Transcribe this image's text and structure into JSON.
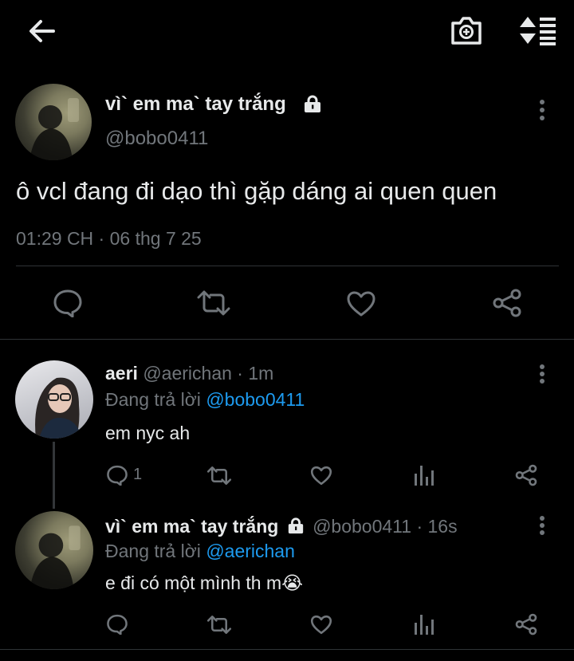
{
  "main_tweet": {
    "display_name": "vì` em ma` tay trắng",
    "handle": "@bobo0411",
    "text": "ô vcl đang đi dạo thì gặp dáng ai quen quen",
    "timestamp": "01:29 CH · 06 thg 7 25"
  },
  "replies": [
    {
      "display_name": "aeri",
      "handle_time": "@aerichan · 1m",
      "replying_prefix": "Đang trả lời",
      "replying_to": "@bobo0411",
      "text": "em nyc ah",
      "reply_count": "1"
    },
    {
      "display_name": "vì` em ma` tay trắng",
      "handle_time": "@bobo0411 · 16s",
      "replying_prefix": "Đang trả lời",
      "replying_to": "@aerichan",
      "text": "e đi có một mình th m😭",
      "reply_count": ""
    }
  ],
  "icons": {
    "back": "arrow-left-icon",
    "camera": "camera-plus-icon",
    "sort": "sort-icon",
    "lock": "lock-icon",
    "more": "more-vertical-icon",
    "reply": "reply-icon",
    "retweet": "retweet-icon",
    "like": "heart-icon",
    "views": "analytics-icon",
    "share": "share-icon"
  },
  "colors": {
    "background": "#000000",
    "text": "#e7e9ea",
    "secondary": "#71767b",
    "accent": "#1d9bf0",
    "divider": "#2f3336"
  }
}
